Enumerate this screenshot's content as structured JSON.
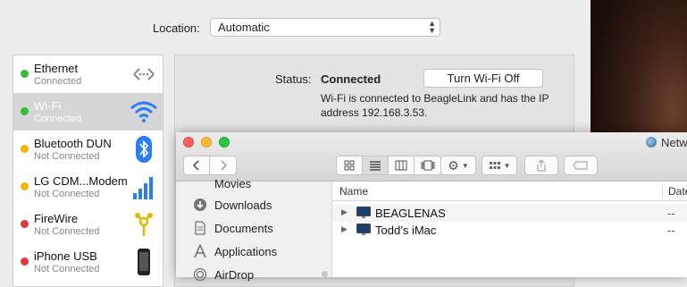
{
  "location": {
    "label": "Location:",
    "value": "Automatic"
  },
  "services": [
    {
      "name": "Ethernet",
      "status": "Connected",
      "dot": "#2fbf3a",
      "icon": "ethernet-icon",
      "selected": false
    },
    {
      "name": "Wi-Fi",
      "status": "Connected",
      "dot": "#2fbf3a",
      "icon": "wifi-icon",
      "selected": true
    },
    {
      "name": "Bluetooth DUN",
      "status": "Not Connected",
      "dot": "#f5b400",
      "icon": "bluetooth-icon",
      "selected": false
    },
    {
      "name": "LG CDM...Modem",
      "status": "Not Connected",
      "dot": "#f5b400",
      "icon": "signal-bars-icon",
      "selected": false
    },
    {
      "name": "FireWire",
      "status": "Not Connected",
      "dot": "#e8333a",
      "icon": "firewire-icon",
      "selected": false
    },
    {
      "name": "iPhone USB",
      "status": "Not Connected",
      "dot": "#e8333a",
      "icon": "iphone-icon",
      "selected": false
    }
  ],
  "detail": {
    "status_label": "Status:",
    "status_value": "Connected",
    "toggle_button": "Turn Wi-Fi Off",
    "description": "Wi-Fi is connected to BeagleLink and has the IP address 192.168.3.53."
  },
  "finder": {
    "title": "Netw",
    "sidebar": [
      {
        "label": "Movies",
        "icon": "movies-icon"
      },
      {
        "label": "Downloads",
        "icon": "downloads-icon"
      },
      {
        "label": "Documents",
        "icon": "documents-icon"
      },
      {
        "label": "Applications",
        "icon": "applications-icon"
      },
      {
        "label": "AirDrop",
        "icon": "airdrop-icon"
      }
    ],
    "columns": {
      "name": "Name",
      "date": "Date"
    },
    "rows": [
      {
        "name": "BEAGLENAS",
        "date": "--"
      },
      {
        "name": "Todd’s iMac",
        "date": "--"
      }
    ]
  },
  "colors": {
    "traffic_close": "#fc5f57",
    "traffic_min": "#fdbc2e",
    "traffic_max": "#28c840",
    "accent": "#2a7ef3"
  }
}
